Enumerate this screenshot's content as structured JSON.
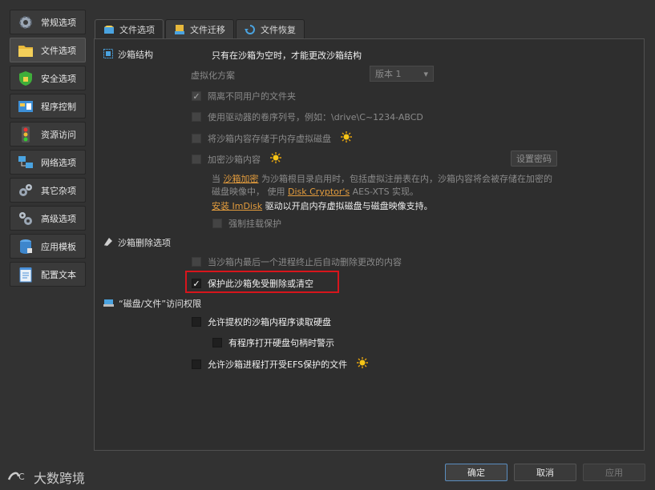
{
  "sidebar": {
    "items": [
      {
        "label": "常规选项",
        "icon": "gear-icon"
      },
      {
        "label": "文件选项",
        "icon": "folder-icon"
      },
      {
        "label": "安全选项",
        "icon": "shield-icon"
      },
      {
        "label": "程序控制",
        "icon": "program-icon"
      },
      {
        "label": "资源访问",
        "icon": "traffic-light-icon"
      },
      {
        "label": "网络选项",
        "icon": "network-icon"
      },
      {
        "label": "其它杂项",
        "icon": "gears-icon"
      },
      {
        "label": "高级选项",
        "icon": "advanced-gears-icon"
      },
      {
        "label": "应用模板",
        "icon": "database-icon"
      },
      {
        "label": "配置文本",
        "icon": "notepad-icon"
      }
    ],
    "active_index": 1
  },
  "tabs": [
    {
      "label": "文件选项",
      "icon": "sandbox-icon"
    },
    {
      "label": "文件迁移",
      "icon": "migrate-icon"
    },
    {
      "label": "文件恢复",
      "icon": "restore-icon"
    }
  ],
  "structure": {
    "title": "沙箱结构",
    "note": "只有在沙箱为空时，才能更改沙箱结构",
    "virt_label": "虚拟化方案",
    "virt_value": "版本 1",
    "opt_isolate": "隔离不同用户的文件夹",
    "opt_volume_serial": "使用驱动器的卷序列号，例如：\\drive\\C~1234-ABCD",
    "opt_ramdisk": "将沙箱内容存储于内存虚拟磁盘",
    "opt_encrypt": "加密沙箱内容",
    "set_password": "设置密码",
    "desc_1a": "当 ",
    "desc_1_link": "沙箱加密",
    "desc_1b": " 为沙箱根目录启用时，包括虚拟注册表在内，沙箱内容将会被存储在加密的",
    "desc_2a": "磁盘映像中， 使用 ",
    "desc_2_link": "Disk Cryptor's",
    "desc_2b": " AES-XTS 实现。",
    "desc_3_link": "安装 ImDisk",
    "desc_3b": " 驱动以开启内存虚拟磁盘与磁盘映像支持。",
    "opt_force_mount": "强制挂载保护"
  },
  "delete": {
    "title": "沙箱删除选项",
    "opt_auto_delete": "当沙箱内最后一个进程终止后自动删除更改的内容",
    "opt_protect": "保护此沙箱免受删除或清空"
  },
  "access": {
    "title": "“磁盘/文件”访问权限",
    "opt_raw_disk": "允许提权的沙箱内程序读取硬盘",
    "opt_warn_handle": "有程序打开硬盘句柄时警示",
    "opt_efs": "允许沙箱进程打开受EFS保护的文件"
  },
  "footer": {
    "ok": "确定",
    "cancel": "取消",
    "apply": "应用"
  },
  "watermark": {
    "text": "大数跨境"
  },
  "colors": {
    "accent": "#e39c3d",
    "highlight": "#d8151c"
  }
}
